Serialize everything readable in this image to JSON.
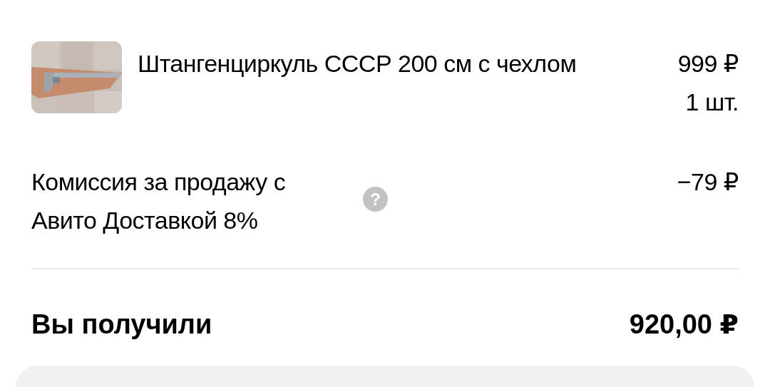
{
  "product": {
    "kind": "picture",
    "title": "Штангенциркуль СССР 200 см с чехлом",
    "price": "999 ₽",
    "quantity": "1 шт."
  },
  "commission": {
    "label": "Комиссия за продажу с Авито Доставкой 8%",
    "help": "?",
    "amount": "−79 ₽"
  },
  "total": {
    "label": "Вы получили",
    "amount": "920,00 ₽"
  }
}
